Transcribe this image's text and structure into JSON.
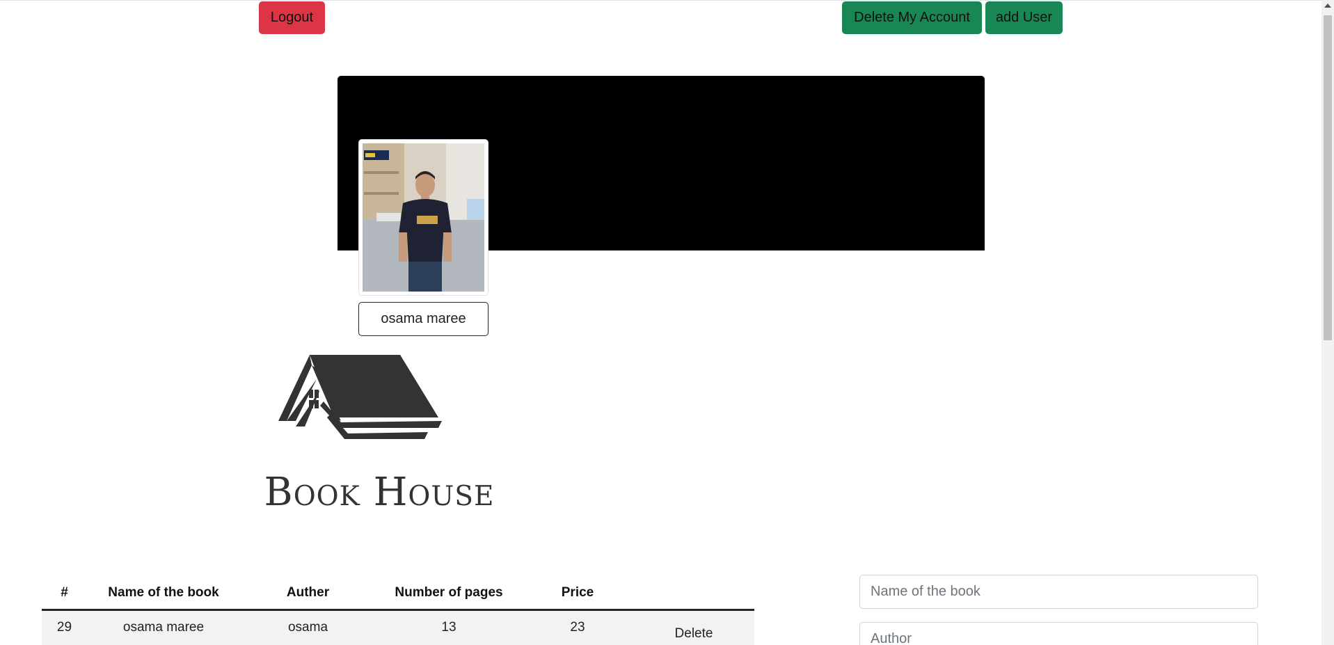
{
  "header": {
    "logout_label": "Logout",
    "delete_account_label": "Delete My Account",
    "add_user_label": "add User"
  },
  "profile": {
    "name": "osama maree"
  },
  "brand": {
    "logo_text": "Book House"
  },
  "table": {
    "columns": [
      "#",
      "Name of the book",
      "Auther",
      "Number of pages",
      "Price",
      ""
    ],
    "rows": [
      {
        "id": "29",
        "name": "osama maree",
        "author": "osama",
        "pages": "13",
        "price": "23",
        "action": "Delete"
      }
    ]
  },
  "form": {
    "book_name_placeholder": "Name of the book",
    "author_placeholder": "Author"
  },
  "colors": {
    "danger": "#dc3545",
    "success": "#198754",
    "cover": "#000000"
  }
}
